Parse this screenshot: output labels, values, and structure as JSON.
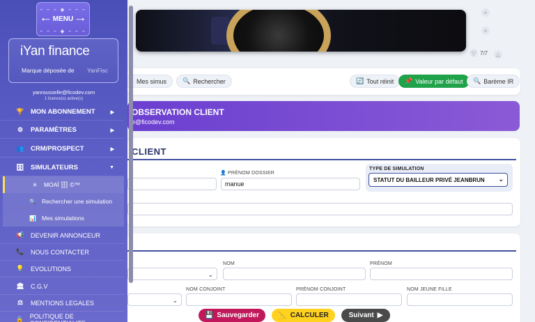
{
  "sidebar": {
    "menu_label": "MENU",
    "menu_dots": "– – – ◆ – – –",
    "logo_text": "iYan finance",
    "logo_tagline": "Marque déposée de",
    "logo_brand": "YanFisc",
    "user_email": "yanrousselle@ficodev.com",
    "licence": "1 licence(s) active(s)",
    "items": [
      {
        "icon": "🏆",
        "label": "MON ABONNEMENT",
        "arrow": "▶"
      },
      {
        "icon": "⚙",
        "label": "PARAMÈTRES",
        "arrow": "▶"
      },
      {
        "icon": "👥",
        "label": "CRM/PROSPECT",
        "arrow": "▶"
      },
      {
        "icon": "🗄",
        "label": "SIMULATEURS",
        "arrow": "▼"
      }
    ],
    "sub_items": [
      {
        "icon": "✳",
        "label": "MOAÏ 🗄 ©™"
      },
      {
        "icon": "🔍",
        "label": "Rechercher une simulation"
      },
      {
        "icon": "📊",
        "label": "Mes simulations"
      }
    ],
    "links": [
      {
        "icon": "📢",
        "label": "DEVENIR ANNONCEUR"
      },
      {
        "icon": "📞",
        "label": "NOUS CONTACTER"
      },
      {
        "icon": "💡",
        "label": "EVOLUTIONS"
      },
      {
        "icon": "🏛",
        "label": "C.G.V"
      },
      {
        "icon": "⚖",
        "label": "MENTIONS LEGALES"
      },
      {
        "icon": "🔒",
        "label": "POLITIQUE DE CONFIDENTIALITE"
      }
    ]
  },
  "banner": {
    "counter": "7/7"
  },
  "toolbar": {
    "mes_simus": "Mes simus",
    "rechercher": "Rechercher",
    "tout_reinit": "Tout réinit",
    "valeur_defaut": "Valeur par défaut",
    "bareme": "Barème IR"
  },
  "observation": {
    "title": "OBSERVATION CLIENT",
    "email_fragment": "e@ficodev.com"
  },
  "client": {
    "title": "CLIENT",
    "prenom_label": "👤 PRÉNOM DOSSIER",
    "prenom_value": "manue",
    "sim_label": "TYPE DE SIMULATION",
    "sim_value": "STATUT DU BAILLEUR PRIVÉ JEANBRUN"
  },
  "identity": {
    "nom": "NOM",
    "prenom": "PRÉNOM",
    "nom_conjoint": "NOM CONJOINT",
    "prenom_conjoint": "PRÉNOM CONJOINT",
    "nom_jeune_fille": "NOM JEUNE FILLE"
  },
  "actions": {
    "save": "Sauvegarder",
    "calc": "CALCULER",
    "next": "Suivant"
  },
  "colors": {
    "save": "#c0185a",
    "calc": "#ffd21f",
    "next": "#4a4a4a",
    "green": "#1fa24a",
    "sidebar": "#5a5cc4"
  }
}
